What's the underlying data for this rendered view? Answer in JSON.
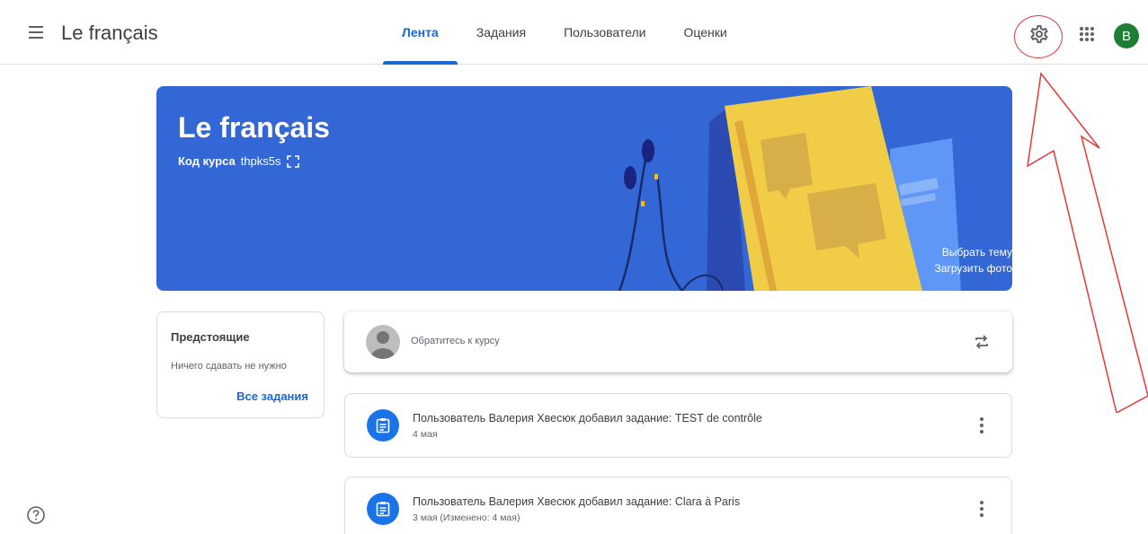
{
  "header": {
    "app_title": "Le français",
    "tabs": [
      {
        "label": "Лента",
        "active": true
      },
      {
        "label": "Задания",
        "active": false
      },
      {
        "label": "Пользователи",
        "active": false
      },
      {
        "label": "Оценки",
        "active": false
      }
    ],
    "avatar_letter": "B",
    "icons": [
      "menu-icon",
      "gear-icon",
      "apps-grid-icon"
    ]
  },
  "banner": {
    "course_title": "Le français",
    "code_label": "Код курса",
    "code_value": "thpks5s",
    "choose_theme": "Выбрать тему",
    "upload_photo": "Загрузить фото"
  },
  "upcoming": {
    "title": "Предстоящие",
    "empty_text": "Ничего сдавать не нужно",
    "all_link": "Все задания"
  },
  "share": {
    "placeholder": "Обратитесь к курсу"
  },
  "stream": [
    {
      "title": "Пользователь Валерия Хвесюк добавил задание: TEST de contrôle",
      "date": "4 мая"
    },
    {
      "title": "Пользователь Валерия Хвесюк добавил задание: Clara à Paris",
      "date": "3 мая (Изменено: 4 мая)"
    }
  ],
  "colors": {
    "accent": "#1967d2",
    "banner": "#3367d6",
    "avatar": "#1e7e34",
    "annotation": "#e53935"
  }
}
